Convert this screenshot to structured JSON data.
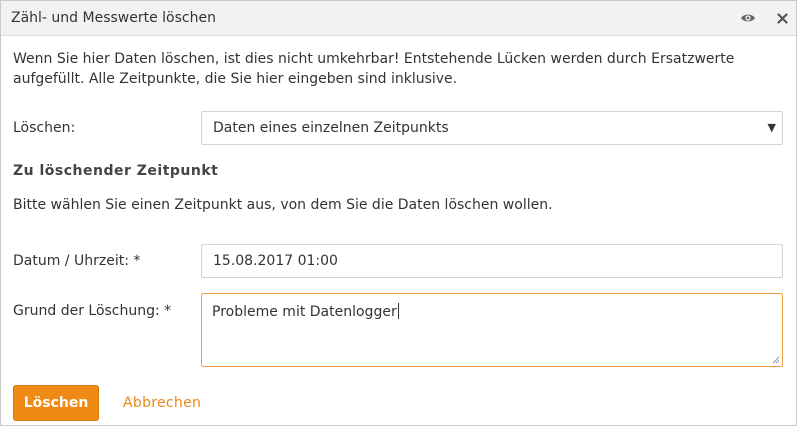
{
  "dialog": {
    "title": "Zähl- und Messwerte löschen",
    "icons": {
      "view": "eye-icon",
      "close": "close-icon"
    }
  },
  "intro": {
    "text": "Wenn Sie hier Daten löschen, ist dies nicht umkehrbar! Entstehende Lücken werden durch Ersatzwerte aufgefüllt. Alle Zeitpunkte, die Sie hier eingeben sind inklusive."
  },
  "form": {
    "delete_mode": {
      "label": "Löschen:",
      "selected": "Daten eines einzelnen Zeitpunkts"
    },
    "section_heading": "Zu löschender Zeitpunkt",
    "hint": "Bitte wählen Sie einen Zeitpunkt aus, von dem Sie die Daten löschen wollen.",
    "datetime": {
      "label": "Datum / Uhrzeit: *",
      "value": "15.08.2017 01:00"
    },
    "reason": {
      "label": "Grund der Löschung: *",
      "value": "Probleme mit Datenlogger"
    }
  },
  "actions": {
    "delete_label": "Löschen",
    "cancel_label": "Abbrechen"
  },
  "colors": {
    "accent": "#ef8a14",
    "link": "#e8891a",
    "focus_border": "#f0a04b",
    "titlebar_bg": "#f2f2f2"
  }
}
